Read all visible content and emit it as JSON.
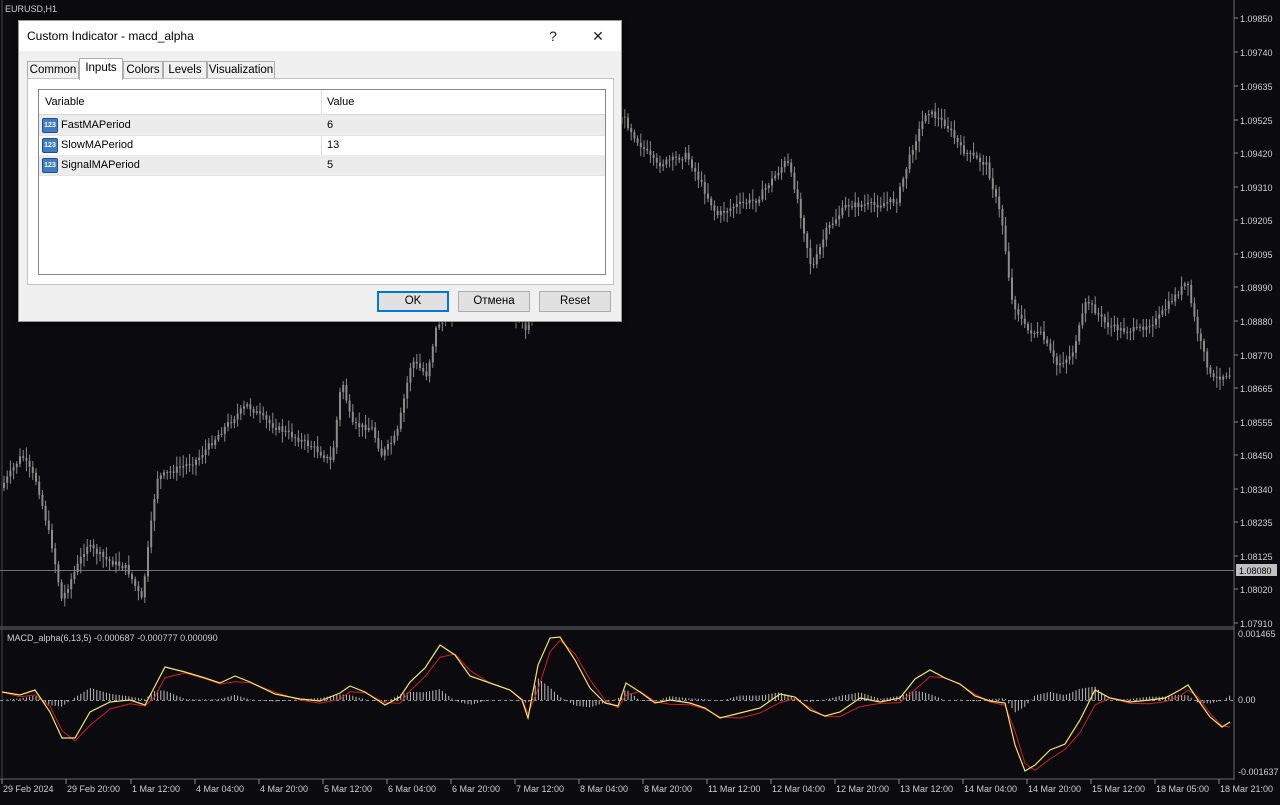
{
  "chart": {
    "symbol_label": "EURUSD,H1",
    "price_ticks": [
      "1.09850",
      "1.09740",
      "1.09635",
      "1.09525",
      "1.09420",
      "1.09310",
      "1.09205",
      "1.09095",
      "1.08990",
      "1.08880",
      "1.08770",
      "1.08665",
      "1.08555",
      "1.08450",
      "1.08340",
      "1.08235",
      "1.08125",
      "1.08020",
      "1.07910"
    ],
    "current_price": "1.08080",
    "indicator_label": "MACD_alpha(6,13,5) -0.000687 -0.000777 0.000090",
    "indicator_ticks": [
      "0.001465",
      "0.00",
      "-0.001637"
    ],
    "time_labels": [
      "29 Feb 2024",
      "29 Feb 20:00",
      "1 Mar 12:00",
      "4 Mar 04:00",
      "4 Mar 20:00",
      "5 Mar 12:00",
      "6 Mar 04:00",
      "6 Mar 20:00",
      "7 Mar 12:00",
      "8 Mar 04:00",
      "8 Mar 20:00",
      "11 Mar 12:00",
      "12 Mar 04:00",
      "12 Mar 20:00",
      "13 Mar 12:00",
      "14 Mar 04:00",
      "14 Mar 20:00",
      "15 Mar 12:00",
      "18 Mar 05:00",
      "18 Mar 21:00"
    ],
    "colors": {
      "background": "#0a0a0f",
      "candle": "#8c8c8c",
      "macd_line": "#f5e663",
      "signal_line": "#d02020",
      "histogram": "#bdbdbd"
    }
  },
  "dialog": {
    "title": "Custom Indicator - macd_alpha",
    "help": "?",
    "close": "✕",
    "tabs": [
      "Common",
      "Inputs",
      "Colors",
      "Levels",
      "Visualization"
    ],
    "active_tab": "Inputs",
    "columns": [
      "Variable",
      "Value"
    ],
    "icon_text": "123",
    "rows": [
      {
        "name": "FastMAPeriod",
        "value": "6"
      },
      {
        "name": "SlowMAPeriod",
        "value": "13"
      },
      {
        "name": "SignalMAPeriod",
        "value": "5"
      }
    ],
    "buttons": {
      "ok": "OK",
      "cancel": "Отмена",
      "reset": "Reset"
    }
  }
}
